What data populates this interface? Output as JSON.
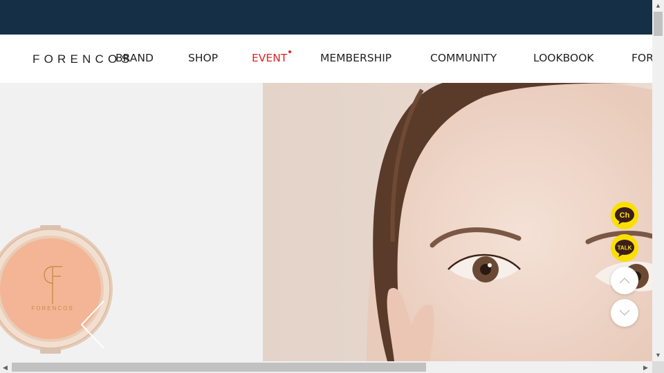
{
  "brand": {
    "logo_text": "FORENCOS"
  },
  "nav": {
    "items": [
      {
        "label": "BRAND"
      },
      {
        "label": "SHOP"
      },
      {
        "label": "EVENT",
        "highlight": true
      },
      {
        "label": "MEMBERSHIP"
      },
      {
        "label": "COMMUNITY"
      },
      {
        "label": "LOOKBOOK"
      },
      {
        "label": "FOR"
      }
    ]
  },
  "hero": {
    "product_brand_text": "FORENCOS",
    "product_monogram": "F",
    "product_icon": "blush-compact-image",
    "model_icon": "model-portrait-image"
  },
  "floating": {
    "channel_label": "Ch",
    "talk_label": "TALK",
    "scroll_up_icon": "chevron-up-icon",
    "scroll_down_icon": "chevron-down-icon"
  },
  "colors": {
    "topbar": "#142f46",
    "event_accent": "#e02020",
    "kakao_yellow": "#f9e000",
    "compact_peach": "#f3b595",
    "gold": "#c58d4b"
  }
}
